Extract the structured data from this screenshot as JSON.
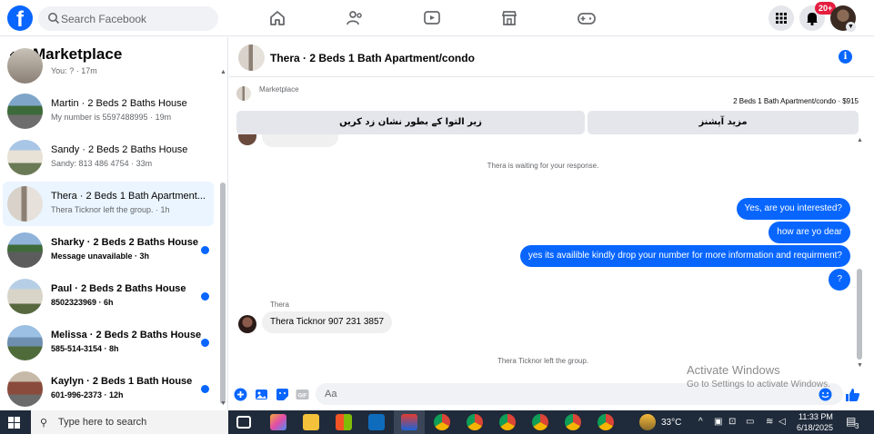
{
  "app": {
    "brand_letter": "f"
  },
  "search": {
    "placeholder": "Search Facebook"
  },
  "top_nav": [
    "home-icon",
    "friends-icon",
    "video-icon",
    "marketplace-icon",
    "gaming-icon"
  ],
  "top_right": {
    "notification_badge": "20+"
  },
  "sidebar": {
    "title": "Marketplace",
    "partial_item": {
      "preview": "You: ? · 17m"
    },
    "conversations": [
      {
        "name": "Martin · 2 Beds 2 Baths House",
        "preview": "My number is 5597488995 · 19m",
        "unread": false,
        "active": false
      },
      {
        "name": "Sandy · 2 Beds 2 Baths House",
        "preview": "Sandy: 813 486 4754 · 33m",
        "unread": false,
        "active": false
      },
      {
        "name": "Thera · 2 Beds 1 Bath Apartment...",
        "preview": "Thera Ticknor left the group. · 1h",
        "unread": false,
        "active": true
      },
      {
        "name": "Sharky · 2 Beds 2 Baths House",
        "preview": "Message unavailable · 3h",
        "unread": true,
        "active": false
      },
      {
        "name": "Paul · 2 Beds 2 Baths House",
        "preview": "8502323969 · 6h",
        "unread": true,
        "active": false
      },
      {
        "name": "Melissa · 2 Beds 2 Baths House",
        "preview": "585-514-3154 · 8h",
        "unread": true,
        "active": false
      },
      {
        "name": "Kaylyn · 2 Beds 1 Bath House",
        "preview": "601-996-2373 · 12h",
        "unread": true,
        "active": false
      }
    ]
  },
  "chat": {
    "title": "Thera · 2 Beds 1 Bath Apartment/condo",
    "marketplace_label": "Marketplace",
    "listing": "2 Beds 1 Bath Apartment/condo · $915",
    "action_left": "زیر التوا کے بطور نشان زد کریں",
    "action_right": "مزید آپشنز",
    "waiting_notice": "Thera is waiting for your response.",
    "outgoing": [
      "Yes, are you interested?",
      "how are yo dear",
      "yes its availible kindly drop your number for more information and requirment?",
      "?"
    ],
    "sender_name": "Thera",
    "incoming": "Thera Ticknor 907 231 3857",
    "left_notice": "Thera Ticknor left the group.",
    "composer_placeholder": "Aa"
  },
  "watermark": {
    "line1": "Activate Windows",
    "line2": "Go to Settings to activate Windows."
  },
  "taskbar": {
    "search_placeholder": "Type here to search",
    "weather": "33°C",
    "time": "11:33 PM",
    "date": "6/18/2025",
    "notifications_count": "3"
  },
  "colors": {
    "accent": "#0866ff",
    "bubble_in": "#f0f0f0",
    "active_row": "#ebf5ff",
    "taskbar": "#1f2a3a"
  }
}
